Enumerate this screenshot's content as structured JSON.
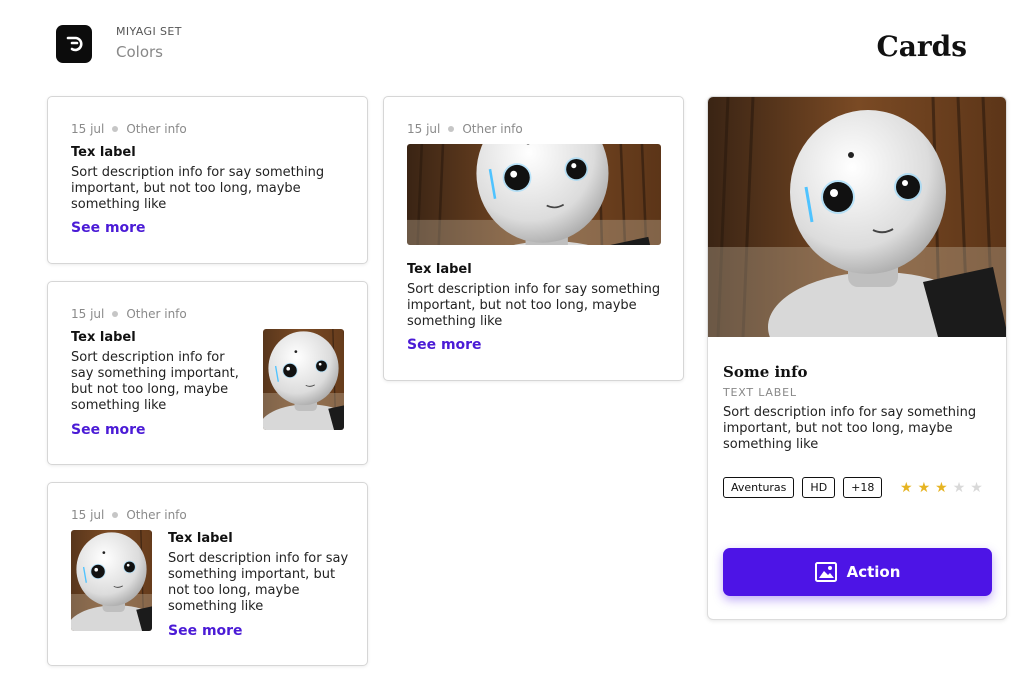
{
  "header": {
    "set_name": "MIYAGI SET",
    "subtitle": "Colors",
    "page_title": "Cards",
    "logo_icon": "miyagi-logo-icon"
  },
  "cards": [
    {
      "date": "15 jul",
      "other": "Other info",
      "label": "Tex label",
      "description": "Sort description info for say something important, but not too long, maybe something like",
      "link": "See more"
    },
    {
      "date": "15 jul",
      "other": "Other info",
      "label": "Tex label",
      "description": "Sort description info for say something important, but not too long, maybe something like",
      "link": "See more"
    },
    {
      "date": "15 jul",
      "other": "Other info",
      "label": "Tex label",
      "description": "Sort description info for say something important, but not too long, maybe something like",
      "link": "See more"
    },
    {
      "date": "15 jul",
      "other": "Other info",
      "label": "Tex label",
      "description": "Sort description info for say something important, but not too long, maybe something like",
      "link": "See more"
    }
  ],
  "feature_card": {
    "title": "Some info",
    "text_label": "TEXT LABEL",
    "description": "Sort description info for say something important, but not too long, maybe something like",
    "tags": [
      "Aventuras",
      "HD",
      "+18"
    ],
    "rating": 3,
    "rating_max": 5,
    "action_label": "Action",
    "action_icon": "image-icon"
  },
  "colors": {
    "accent": "#4d14e6",
    "link": "#4b1bd6",
    "star": "#e6b422"
  }
}
